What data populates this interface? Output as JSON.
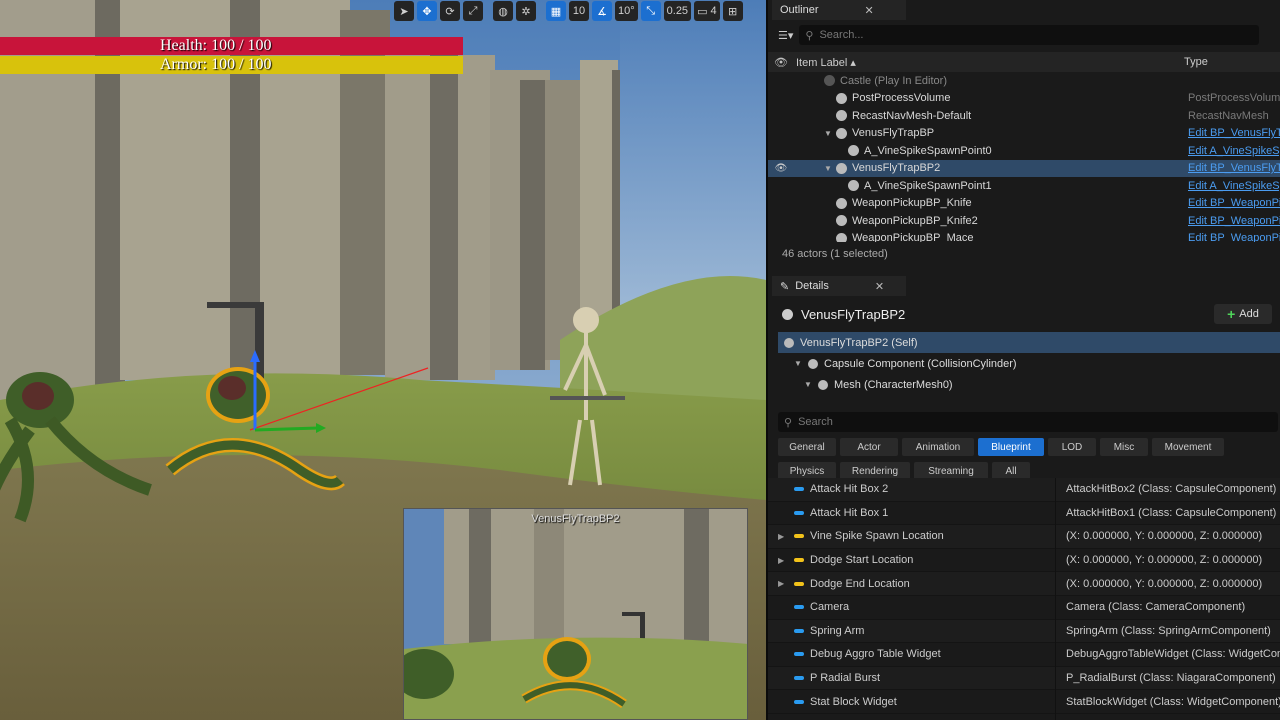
{
  "hud": {
    "health": "Health: 100 / 100",
    "armor": "Armor: 100 / 100"
  },
  "viewport_toolbar": {
    "grid_snap": "10",
    "rotation_snap": "10°",
    "scale_snap": "0.25",
    "camera_speed": "4"
  },
  "pip": {
    "title": "VenusFlyTrapBP2"
  },
  "outliner": {
    "tab_label": "Outliner",
    "search_placeholder": "Search...",
    "col_label": "Item Label ▴",
    "col_type": "Type",
    "rows": [
      {
        "label": "Castle (Play In Editor)",
        "type": "",
        "indent": 0,
        "dim": true,
        "link": false,
        "expander": false,
        "selected": false
      },
      {
        "label": "PostProcessVolume",
        "type": "PostProcessVolum",
        "indent": 1,
        "dim": false,
        "link": false,
        "expander": false,
        "selected": false
      },
      {
        "label": "RecastNavMesh-Default",
        "type": "RecastNavMesh",
        "indent": 1,
        "dim": false,
        "link": false,
        "expander": false,
        "selected": false
      },
      {
        "label": "VenusFlyTrapBP",
        "type": "Edit BP_VenusFlyT",
        "indent": 1,
        "dim": false,
        "link": true,
        "expander": true,
        "selected": false
      },
      {
        "label": "A_VineSpikeSpawnPoint0",
        "type": "Edit A_VineSpikeSp",
        "indent": 2,
        "dim": false,
        "link": true,
        "expander": false,
        "selected": false
      },
      {
        "label": "VenusFlyTrapBP2",
        "type": "Edit BP_VenusFlyT",
        "indent": 1,
        "dim": false,
        "link": true,
        "expander": true,
        "selected": true
      },
      {
        "label": "A_VineSpikeSpawnPoint1",
        "type": "Edit A_VineSpikeSp",
        "indent": 2,
        "dim": false,
        "link": true,
        "expander": false,
        "selected": false
      },
      {
        "label": "WeaponPickupBP_Knife",
        "type": "Edit BP_WeaponPi",
        "indent": 1,
        "dim": false,
        "link": true,
        "expander": false,
        "selected": false
      },
      {
        "label": "WeaponPickupBP_Knife2",
        "type": "Edit BP_WeaponPi",
        "indent": 1,
        "dim": false,
        "link": true,
        "expander": false,
        "selected": false
      },
      {
        "label": "WeaponPickupBP_Mace",
        "type": "Edit BP_WeaponPi",
        "indent": 1,
        "dim": false,
        "link": true,
        "expander": false,
        "selected": false
      }
    ],
    "status": "46 actors (1 selected)"
  },
  "details": {
    "tab_label": "Details",
    "title": "VenusFlyTrapBP2",
    "add_label": "Add",
    "components": [
      {
        "label": "VenusFlyTrapBP2 (Self)",
        "selected": true
      },
      {
        "label": "Capsule Component (CollisionCylinder)",
        "selected": false
      },
      {
        "label": "Mesh (CharacterMesh0)",
        "selected": false
      }
    ],
    "search_placeholder": "Search",
    "categories": [
      {
        "label": "General",
        "active": false
      },
      {
        "label": "Actor",
        "active": false
      },
      {
        "label": "Animation",
        "active": false
      },
      {
        "label": "Blueprint",
        "active": true
      },
      {
        "label": "LOD",
        "active": false
      },
      {
        "label": "Misc",
        "active": false
      },
      {
        "label": "Movement",
        "active": false
      },
      {
        "label": "Physics",
        "active": false
      },
      {
        "label": "Rendering",
        "active": false
      },
      {
        "label": "Streaming",
        "active": false
      },
      {
        "label": "All",
        "active": false
      }
    ],
    "properties": [
      {
        "name": "Attack Hit Box 2",
        "value": "AttackHitBox2 (Class: CapsuleComponent)",
        "pin": "blue",
        "expander": false
      },
      {
        "name": "Attack Hit Box 1",
        "value": "AttackHitBox1 (Class: CapsuleComponent)",
        "pin": "blue",
        "expander": false
      },
      {
        "name": "Vine Spike Spawn Location",
        "value": "(X: 0.000000, Y: 0.000000, Z: 0.000000)",
        "pin": "yellow",
        "expander": true
      },
      {
        "name": "Dodge Start Location",
        "value": "(X: 0.000000, Y: 0.000000, Z: 0.000000)",
        "pin": "yellow",
        "expander": true
      },
      {
        "name": "Dodge End Location",
        "value": "(X: 0.000000, Y: 0.000000, Z: 0.000000)",
        "pin": "yellow",
        "expander": true
      },
      {
        "name": "Camera",
        "value": "Camera (Class: CameraComponent)",
        "pin": "blue",
        "expander": false
      },
      {
        "name": "Spring Arm",
        "value": "SpringArm (Class: SpringArmComponent)",
        "pin": "blue",
        "expander": false
      },
      {
        "name": "Debug Aggro Table Widget",
        "value": "DebugAggroTableWidget (Class: WidgetCon",
        "pin": "blue",
        "expander": false
      },
      {
        "name": "P Radial Burst",
        "value": "P_RadialBurst (Class: NiagaraComponent)",
        "pin": "blue",
        "expander": false
      },
      {
        "name": "Stat Block Widget",
        "value": "StatBlockWidget (Class: WidgetComponent)",
        "pin": "blue",
        "expander": false
      }
    ]
  },
  "colors": {
    "selection": "#2f4a68",
    "accent": "#1c6fd0",
    "health": "#c8143a",
    "armor": "#d8c20c",
    "pin_blue": "#2a9bf0",
    "pin_yellow": "#f2c21a"
  }
}
